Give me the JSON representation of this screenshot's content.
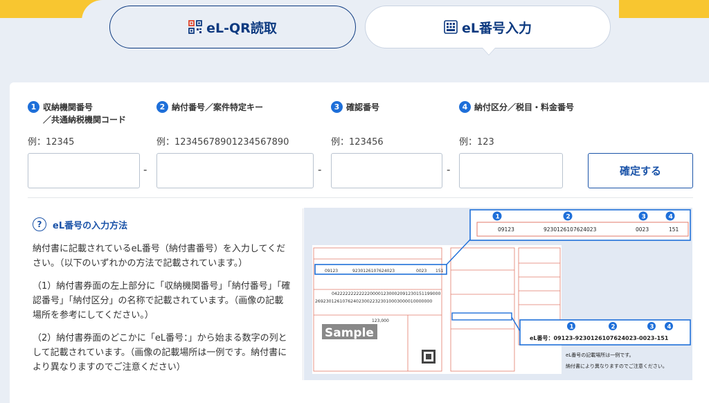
{
  "tabs": {
    "qr": {
      "label": "eL-QR読取",
      "icon": "qr-code-icon"
    },
    "eln": {
      "label": "eL番号入力",
      "icon": "number-grid-icon"
    }
  },
  "fields": [
    {
      "num": "1",
      "label_line1": "収納機関番号",
      "label_line2": "／共通納税機関コード",
      "example": "例：12345",
      "value": ""
    },
    {
      "num": "2",
      "label_line1": "納付番号／案件特定キー",
      "example": "例：12345678901234567890",
      "value": ""
    },
    {
      "num": "3",
      "label_line1": "確認番号",
      "example": "例：123456",
      "value": ""
    },
    {
      "num": "4",
      "label_line1": "納付区分／税目・料金番号",
      "example": "例：123",
      "value": ""
    }
  ],
  "dash": "-",
  "confirm_label": "確定する",
  "help": {
    "title": "eL番号の入力方法",
    "p1": "納付書に記載されているeL番号（納付書番号）を入力してください。（以下のいずれかの方法で記載されています。）",
    "p2": "（1）納付書券面の左上部分に「収納機関番号」「納付番号」「確認番号」「納付区分」の名称で記載されています。（画像の記載場所を参考にしてください。）",
    "p3": "（2）納付書券面のどこかに「eL番号：」から始まる数字の列として記載されています。（画像の記載場所は一例です。納付書により異なりますのでご注意ください）"
  },
  "sample": {
    "callout_nums": [
      "1",
      "2",
      "3",
      "4"
    ],
    "top_values": [
      "09123",
      "9230126107624023",
      "0023",
      "151"
    ],
    "el_line": "eL番号：09123-9230126107624023-0023-151",
    "watermark": "Sample",
    "note_line1": "eL番号の記載場所は一例です。",
    "note_line2": "納付書により異なりますのでご注意ください。",
    "doc_field_1": "09123",
    "doc_field_2": "9230126107624023",
    "doc_field_3": "0023",
    "doc_field_4": "151",
    "doc_barcode": "0422222222222200001230002091230151199000",
    "doc_barcode2": "2692301261076240230022323010003000010000000",
    "amount": "123,000"
  }
}
